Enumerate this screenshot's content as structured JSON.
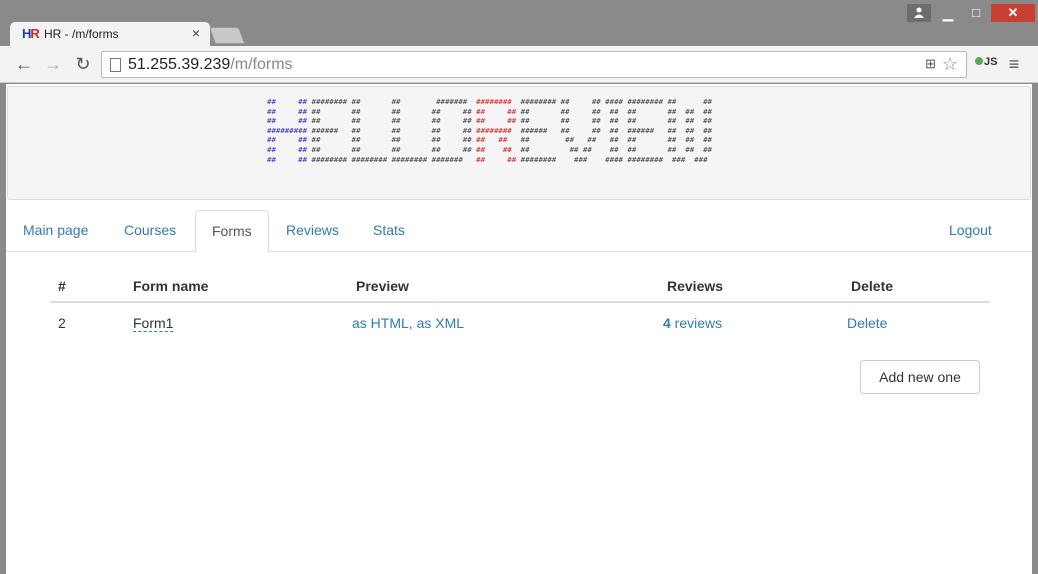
{
  "browser": {
    "tab_title": "HR - /m/forms",
    "favicon": {
      "h": "H",
      "r": "R"
    },
    "url_host": "51.255.39.239",
    "url_path": "/m/forms",
    "ext_label": "JS",
    "icons": {
      "back": "back-arrow-icon",
      "forward": "forward-arrow-icon",
      "reload": "reload-icon",
      "star": "star-icon",
      "translate": "translate-icon",
      "menu": "hamburger-menu-icon"
    }
  },
  "banner": {
    "ascii_lines": [
      [
        "##     ## ######## ##       ##        #######  ",
        "########  ",
        "######## ##     ## #### ######## ##      ##"
      ],
      [
        "##     ## ##       ##       ##       ##     ## ",
        "##     ## ",
        "##       ##     ##  ##  ##       ##  ##  ##"
      ],
      [
        "##     ## ##       ##       ##       ##     ## ",
        "##     ## ",
        "##       ##     ##  ##  ##       ##  ##  ##"
      ],
      [
        "######### ######   ##       ##       ##     ## ",
        "########  ",
        "######   ##     ##  ##  ######   ##  ##  ##"
      ],
      [
        "##     ## ##       ##       ##       ##     ## ",
        "##   ##   ",
        "##        ##   ##   ##  ##       ##  ##  ##"
      ],
      [
        "##     ## ##       ##       ##       ##     ## ",
        "##    ##  ",
        "##         ## ##    ##  ##       ##  ##  ##"
      ],
      [
        "##     ## ######## ######## ######## ####### ",
        "  ##     ## ",
        "########    ###    #### ########  ###  ###"
      ]
    ]
  },
  "nav": {
    "tabs": [
      "Main page",
      "Courses",
      "Forms",
      "Reviews",
      "Stats"
    ],
    "logout": "Logout"
  },
  "table": {
    "headers": [
      "#",
      "Form name",
      "Preview",
      "Reviews",
      "Delete"
    ],
    "rows": [
      {
        "id": "2",
        "name": "Form1",
        "preview_html": "as HTML",
        "sep": ", ",
        "preview_xml": "as XML",
        "reviews_count": "4",
        "reviews_label": " reviews",
        "delete": "Delete"
      }
    ]
  },
  "add_button": "Add new one"
}
